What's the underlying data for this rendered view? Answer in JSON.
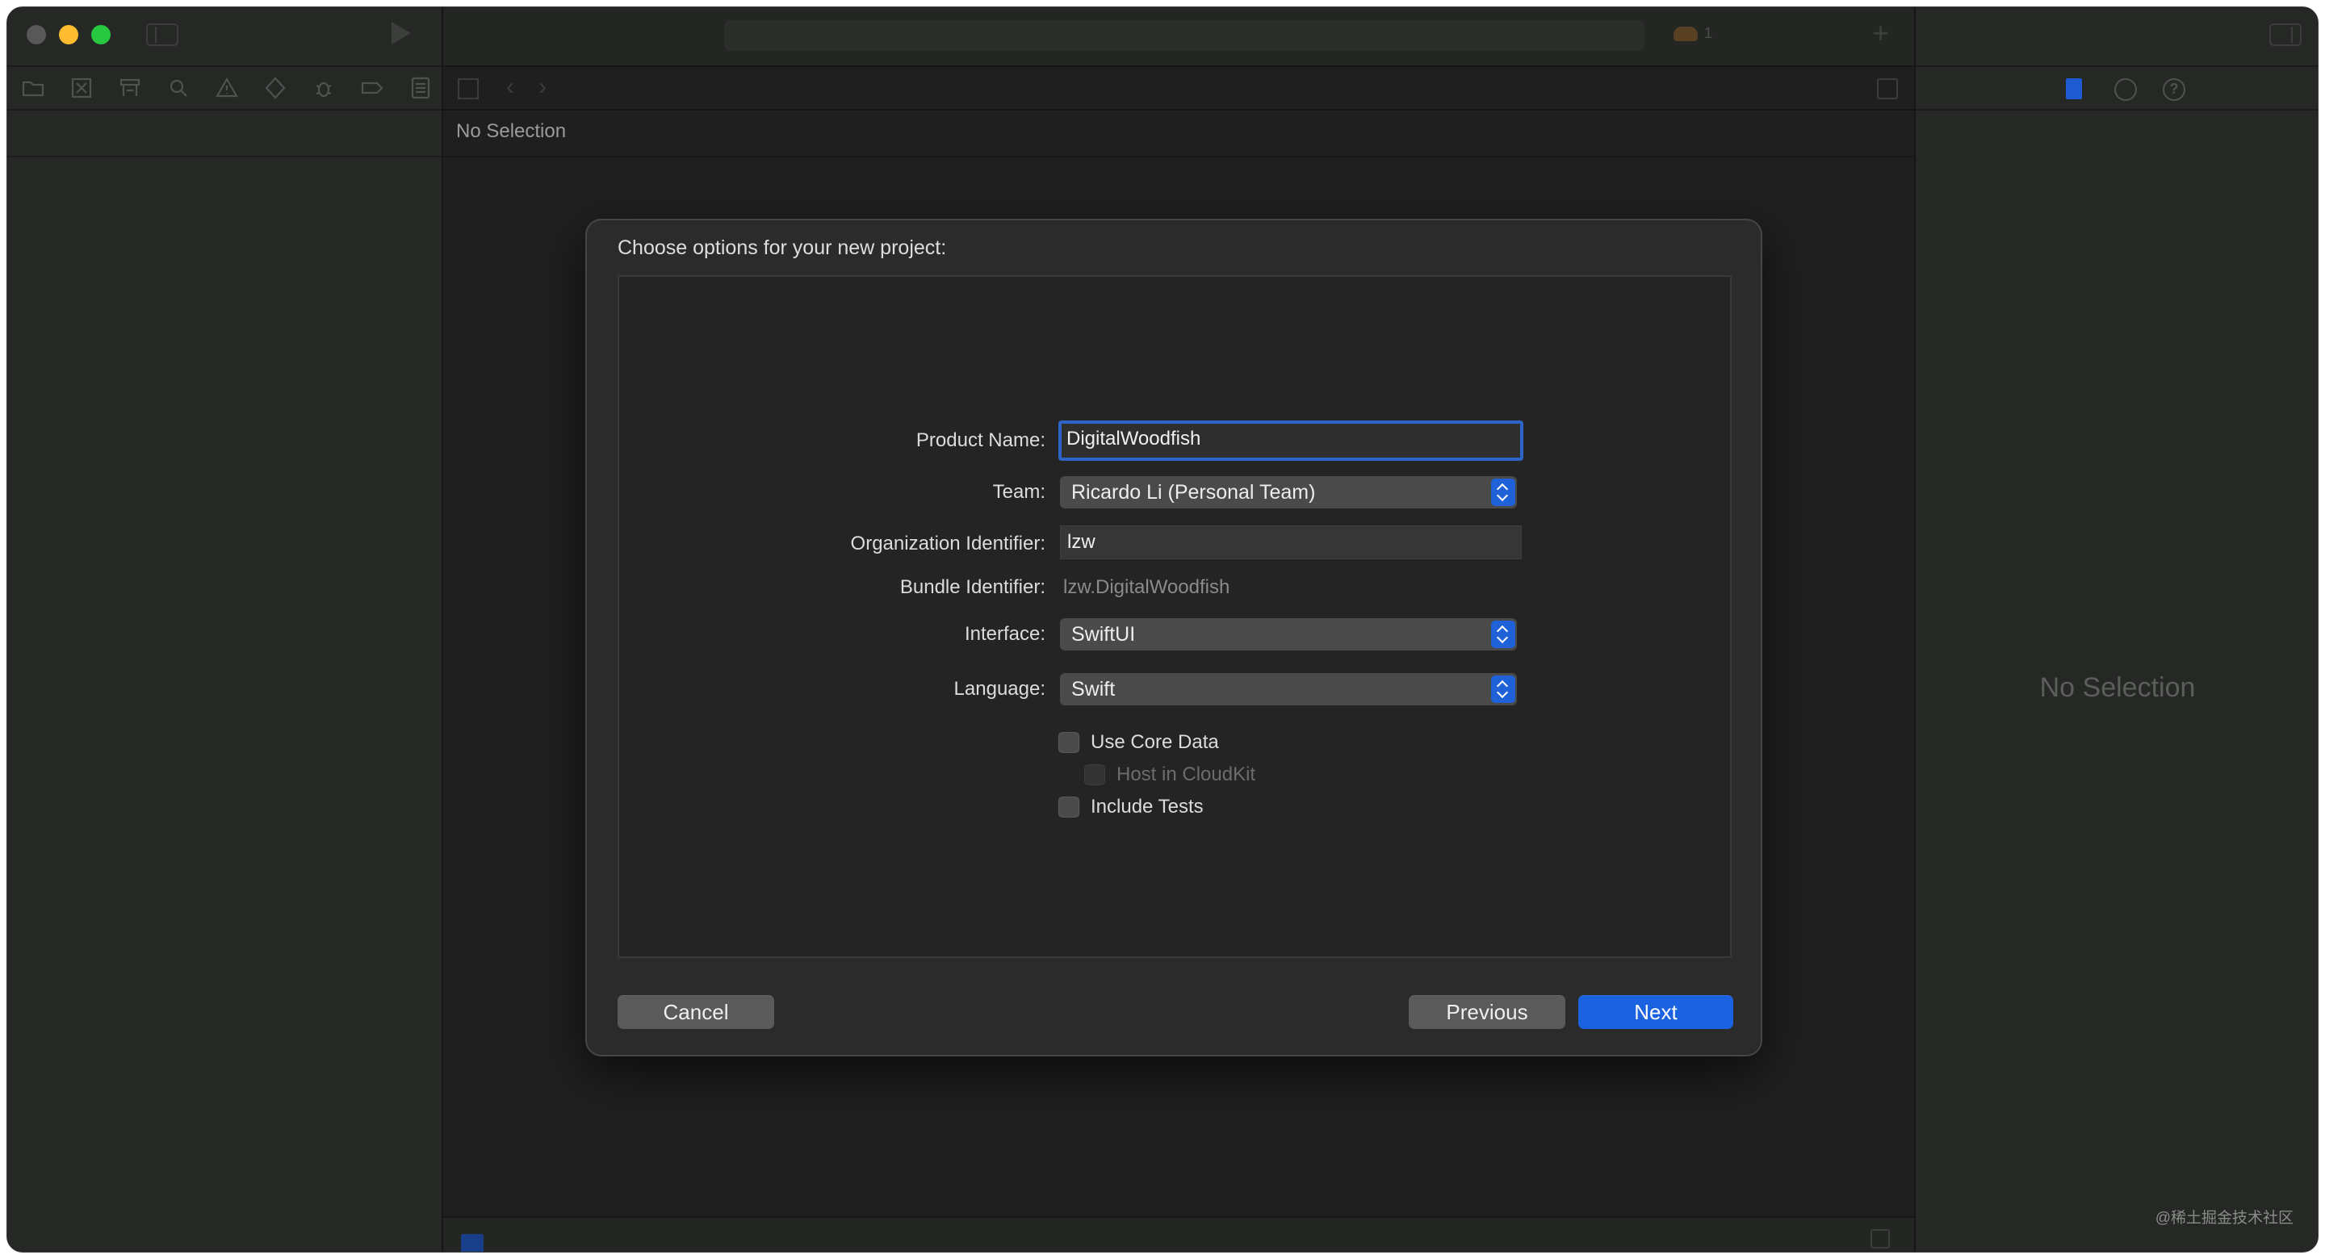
{
  "window": {
    "editor_no_selection": "No Selection",
    "inspector_no_selection": "No Selection",
    "issue_count": "1",
    "watermark": "@稀土掘金技术社区"
  },
  "dialog": {
    "title": "Choose options for your new project:",
    "fields": {
      "product_name": {
        "label": "Product Name:",
        "value": "DigitalWoodfish"
      },
      "team": {
        "label": "Team:",
        "value": "Ricardo Li (Personal Team)"
      },
      "org_identifier": {
        "label": "Organization Identifier:",
        "value": "lzw"
      },
      "bundle_identifier": {
        "label": "Bundle Identifier:",
        "value": "lzw.DigitalWoodfish"
      },
      "interface": {
        "label": "Interface:",
        "value": "SwiftUI"
      },
      "language": {
        "label": "Language:",
        "value": "Swift"
      }
    },
    "checkboxes": {
      "use_core_data": {
        "label": "Use Core Data",
        "checked": false
      },
      "host_in_cloudkit": {
        "label": "Host in CloudKit",
        "checked": false,
        "enabled": false
      },
      "include_tests": {
        "label": "Include Tests",
        "checked": false
      }
    },
    "buttons": {
      "cancel": "Cancel",
      "previous": "Previous",
      "next": "Next"
    }
  },
  "colors": {
    "accent": "#1a62e0",
    "focus_ring": "#2e64c8",
    "window_bg": "#1e1f1e"
  },
  "icons": {
    "navigator": [
      "folder-icon",
      "source-control-icon",
      "symbol-icon",
      "search-icon",
      "warning-icon",
      "test-icon",
      "debug-icon",
      "breakpoint-icon",
      "report-icon"
    ],
    "inspector": [
      "file-icon",
      "history-icon",
      "help-icon"
    ]
  }
}
